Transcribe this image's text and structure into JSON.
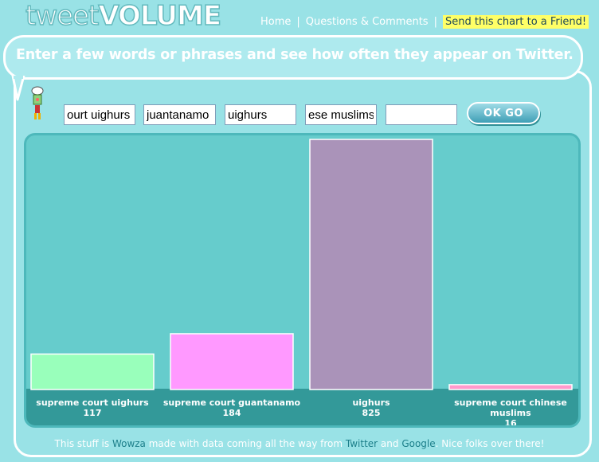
{
  "logo": {
    "part1": "tweet",
    "part2": "VOLUME"
  },
  "nav": {
    "home": "Home",
    "separator": "|",
    "questions": "Questions & Comments",
    "send": "Send this chart to a Friend!"
  },
  "banner": "Enter a few words or phrases and see how often they appear on Twitter.",
  "inputs": [
    {
      "value": "ourt uighurs"
    },
    {
      "value": "juantanamo"
    },
    {
      "value": "uighurs"
    },
    {
      "value": "ese muslims"
    },
    {
      "value": ""
    }
  ],
  "button": "OK GO",
  "chart_data": {
    "type": "bar",
    "title": "",
    "xlabel": "",
    "ylabel": "",
    "categories": [
      "supreme court uighurs",
      "supreme court guantanamo",
      "uighurs",
      "supreme court chinese muslims"
    ],
    "values": [
      117,
      184,
      825,
      16
    ],
    "colors": [
      "#99ffbb",
      "#ff99ff",
      "#aa93b9",
      "#ff99cc"
    ],
    "ylim": [
      0,
      825
    ],
    "grid": false,
    "legend": "none"
  },
  "footer": {
    "t1": "This stuff is ",
    "wowza": "Wowza",
    "t2": " made with data coming all the way from ",
    "twitter": "Twitter",
    "t3": " and ",
    "google": "Google",
    "t4": ". Nice folks over there!"
  },
  "colors": {
    "page_bg": "#99e2e6",
    "chart_bg": "#66cccc",
    "label_band": "#339999",
    "highlight": "#ffff66"
  }
}
